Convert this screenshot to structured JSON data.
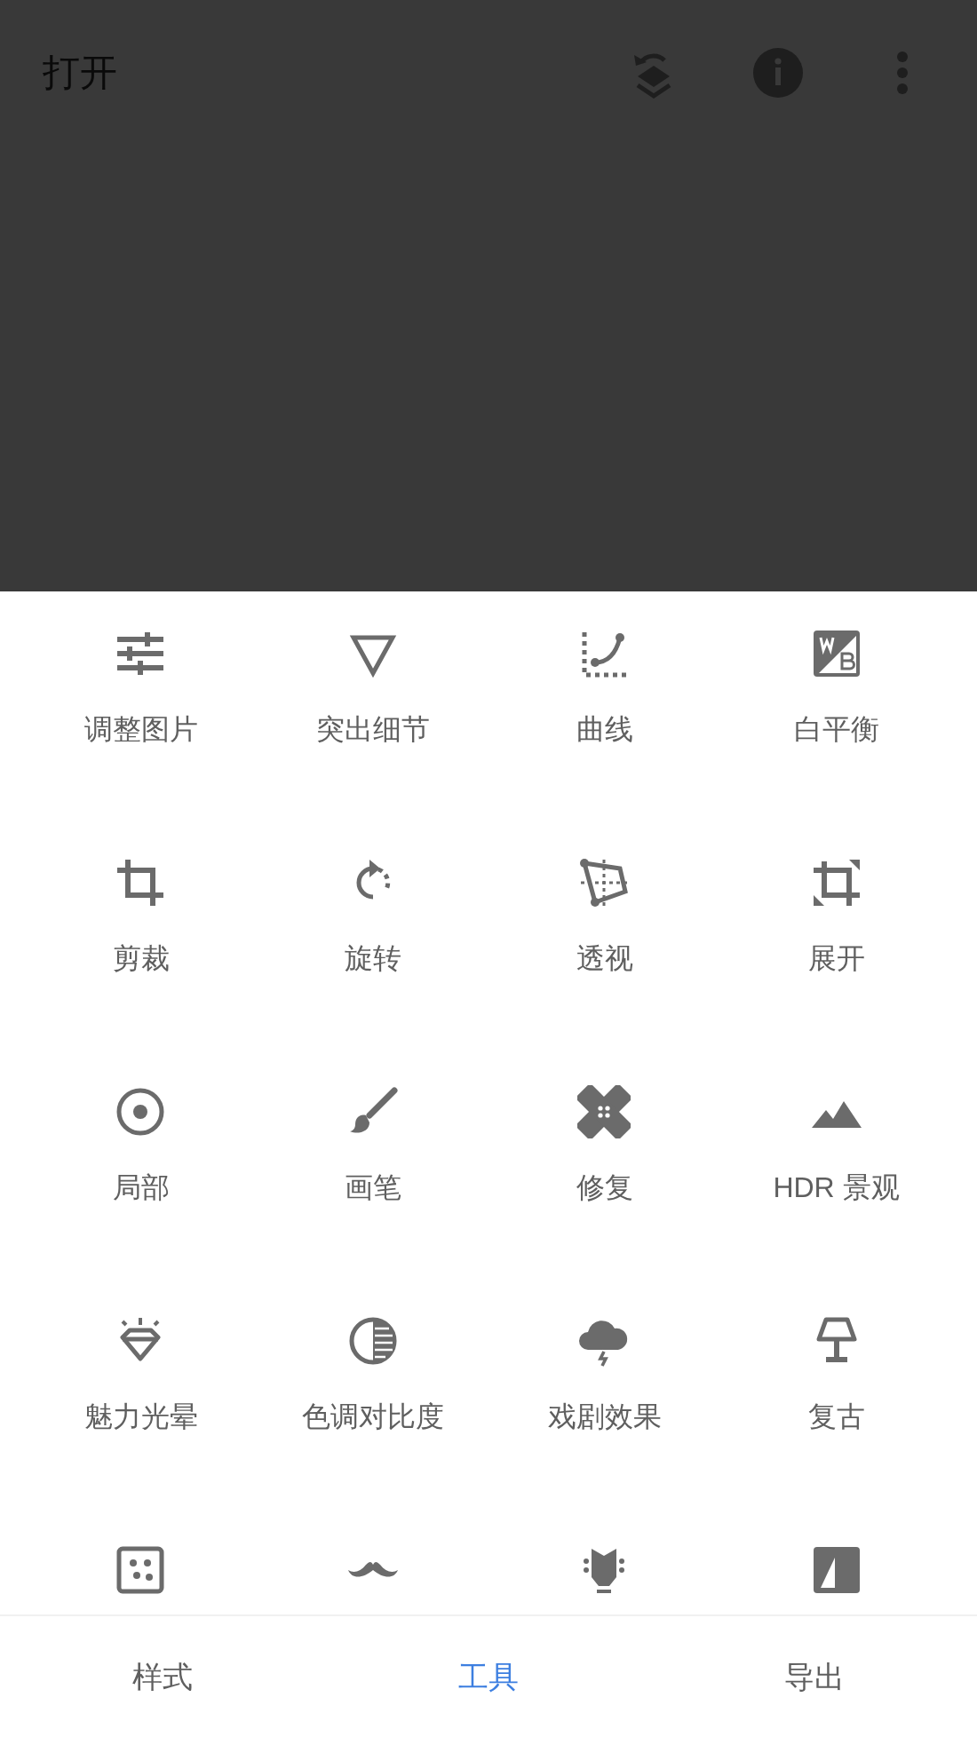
{
  "header": {
    "title": "打开"
  },
  "tools": [
    {
      "kind": "tune",
      "label": "调整图片"
    },
    {
      "kind": "details",
      "label": "突出细节"
    },
    {
      "kind": "curves",
      "label": "曲线"
    },
    {
      "kind": "wb",
      "label": "白平衡"
    },
    {
      "kind": "crop",
      "label": "剪裁"
    },
    {
      "kind": "rotate",
      "label": "旋转"
    },
    {
      "kind": "perspective",
      "label": "透视"
    },
    {
      "kind": "expand",
      "label": "展开"
    },
    {
      "kind": "selective",
      "label": "局部"
    },
    {
      "kind": "brush",
      "label": "画笔"
    },
    {
      "kind": "healing",
      "label": "修复"
    },
    {
      "kind": "hdr",
      "label": "HDR 景观"
    },
    {
      "kind": "glamour",
      "label": "魅力光晕"
    },
    {
      "kind": "tonal",
      "label": "色调对比度"
    },
    {
      "kind": "drama",
      "label": "戏剧效果"
    },
    {
      "kind": "vintage",
      "label": "复古"
    },
    {
      "kind": "grain"
    },
    {
      "kind": "mustache"
    },
    {
      "kind": "guitar"
    },
    {
      "kind": "frame"
    }
  ],
  "tabs": [
    {
      "label": "样式",
      "selected": false
    },
    {
      "label": "工具",
      "selected": true
    },
    {
      "label": "导出",
      "selected": false
    }
  ]
}
